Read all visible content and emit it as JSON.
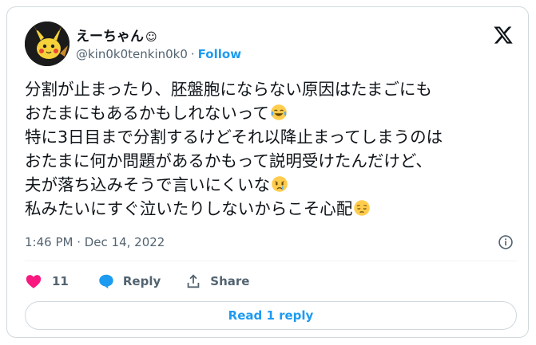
{
  "author": {
    "display_name": "えーちゃん",
    "display_name_symbol": "☺",
    "handle": "@kin0k0tenkin0k0",
    "separator": "·",
    "follow_label": "Follow"
  },
  "tweet": {
    "line1": "分割が止まったり、胚盤胞にならない原因はたまごにも",
    "line2": "おたまにもあるかもしれないって",
    "line3": "特に3日目まで分割するけどそれ以降止まってしまうのは",
    "line4": "おたまに何か問題があるかもって説明受けたんだけど、",
    "line5": "夫が落ち込みそうで言いにくいな",
    "line6": "私みたいにすぐ泣いたりしないからこそ心配",
    "emojis": [
      "face-with-tears-of-joy",
      "crying-face",
      "pensive-face"
    ]
  },
  "timestamp": "1:46 PM · Dec 14, 2022",
  "actions": {
    "like_count": "11",
    "reply_label": "Reply",
    "share_label": "Share"
  },
  "read_replies_label": "Read 1 reply",
  "colors": {
    "accent": "#1d9bf0",
    "like": "#f91880",
    "text": "#0f1419",
    "muted": "#536471",
    "border": "#cfd9de"
  }
}
